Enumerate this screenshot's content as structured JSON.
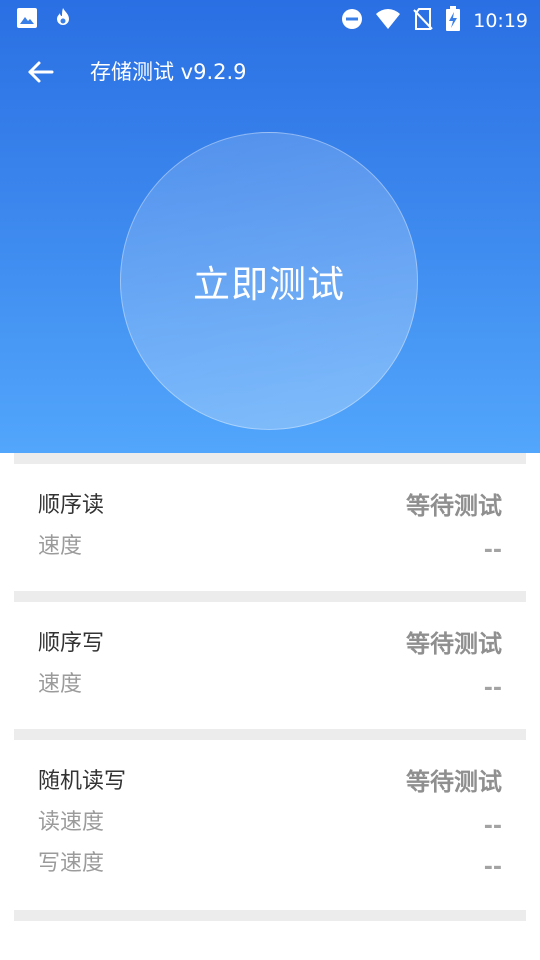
{
  "status_bar": {
    "time": "10:19",
    "left_icons": [
      "image-icon",
      "flame-icon"
    ],
    "right_icons": [
      "dnd-icon",
      "wifi-icon",
      "no-sim-icon",
      "battery-charging-icon"
    ]
  },
  "app_bar": {
    "title": "存储测试 v9.2.9",
    "back_icon": "arrow-back-icon"
  },
  "main": {
    "start_button_label": "立即测试"
  },
  "sections": {
    "seq_read": {
      "title": "顺序读",
      "status": "等待测试",
      "rows": [
        {
          "label": "速度",
          "value": "--"
        }
      ]
    },
    "seq_write": {
      "title": "顺序写",
      "status": "等待测试",
      "rows": [
        {
          "label": "速度",
          "value": "--"
        }
      ]
    },
    "random_rw": {
      "title": "随机读写",
      "status": "等待测试",
      "rows": [
        {
          "label": "读速度",
          "value": "--"
        },
        {
          "label": "写速度",
          "value": "--"
        }
      ]
    }
  },
  "colors": {
    "header_top": "#2a6fe3",
    "header_bottom": "#52a6fb",
    "divider": "#ececec",
    "title_text": "#333333",
    "secondary_text": "#9b9b9b"
  }
}
